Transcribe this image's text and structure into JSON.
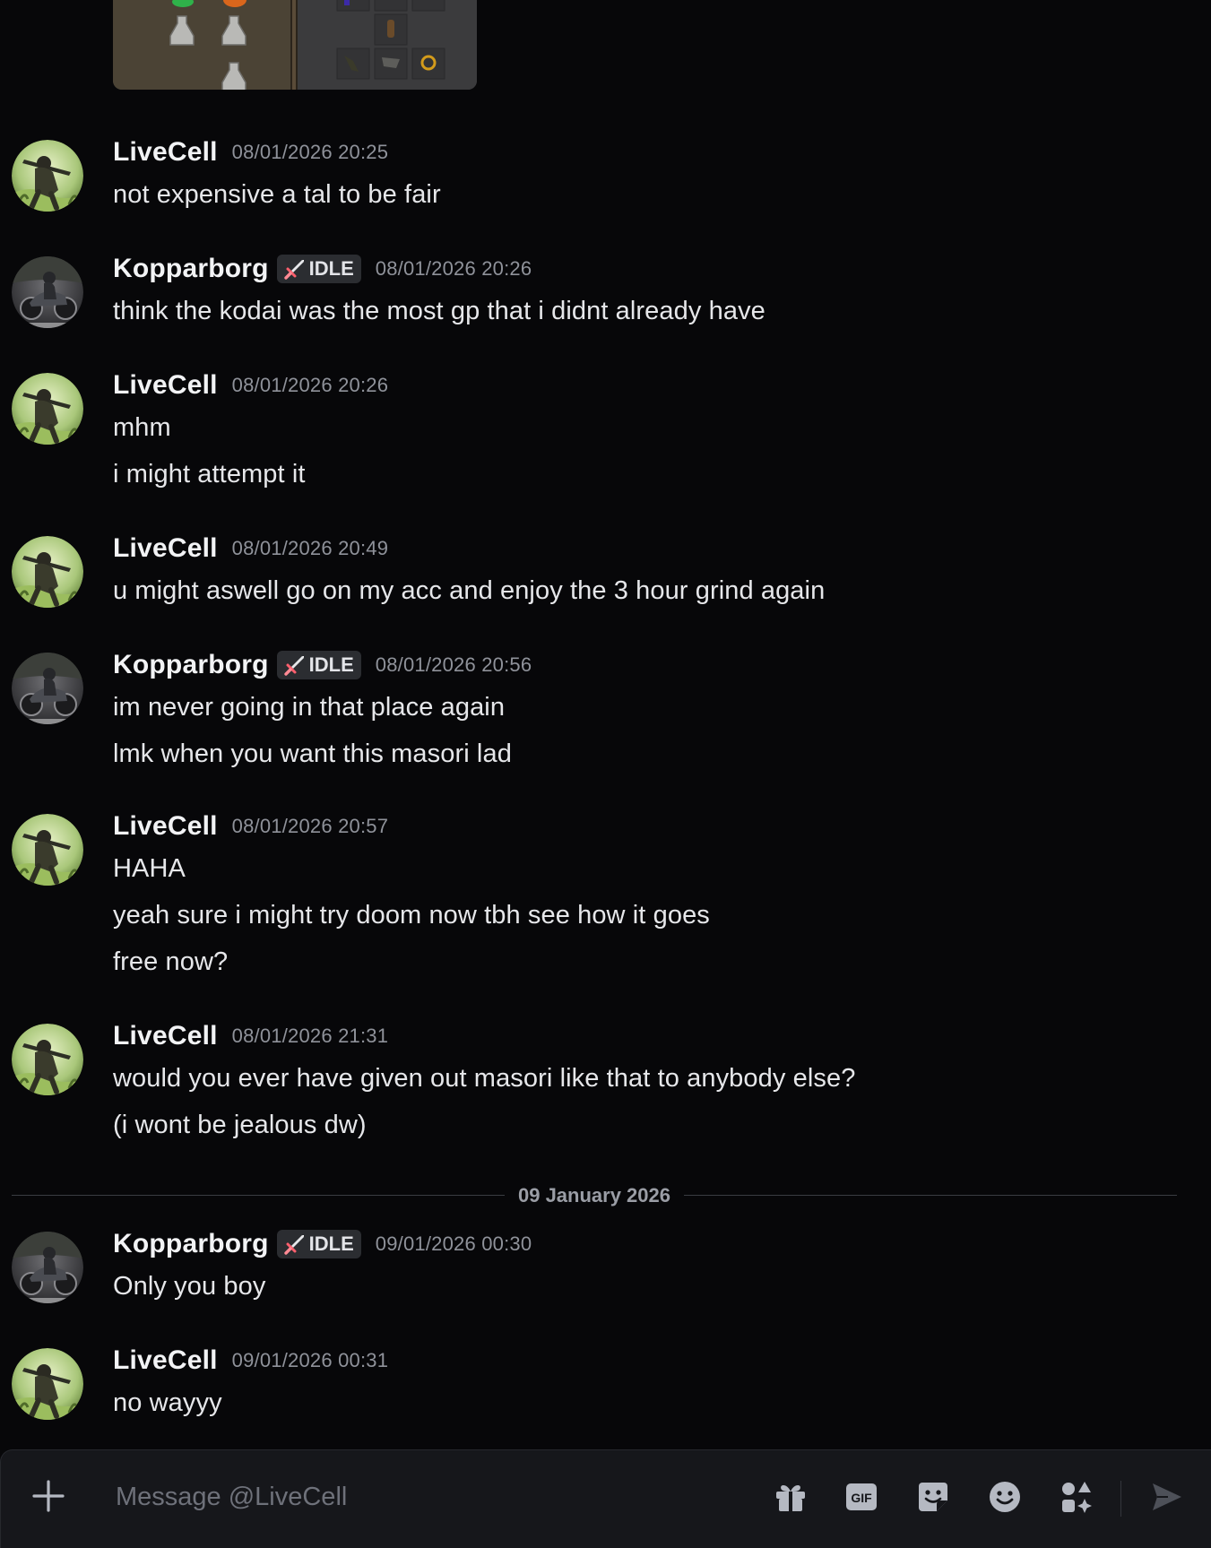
{
  "users": {
    "livecell": {
      "name": "LiveCell",
      "avatar_icon": "soldier-avatar-icon"
    },
    "kopparborg": {
      "name": "Kopparborg",
      "avatar_icon": "motorbike-avatar-icon",
      "tag": "IDLE",
      "tag_icon": "sword-icon"
    }
  },
  "groups": [
    {
      "user": "LiveCell",
      "timestamp": "08/01/2026 20:25",
      "lines": [
        "not expensive a tal to be fair"
      ]
    },
    {
      "user": "Kopparborg",
      "tag": "IDLE",
      "timestamp": "08/01/2026 20:26",
      "lines": [
        "think the kodai was the most gp that i didnt already have"
      ]
    },
    {
      "user": "LiveCell",
      "timestamp": "08/01/2026 20:26",
      "lines": [
        "mhm",
        "i might attempt it"
      ]
    },
    {
      "user": "LiveCell",
      "timestamp": "08/01/2026 20:49",
      "lines": [
        "u might aswell go on my acc and enjoy the 3 hour grind again"
      ]
    },
    {
      "user": "Kopparborg",
      "tag": "IDLE",
      "timestamp": "08/01/2026 20:56",
      "lines": [
        "im never going in that place again",
        "lmk when you want this masori lad"
      ]
    },
    {
      "user": "LiveCell",
      "timestamp": "08/01/2026 20:57",
      "lines": [
        "HAHA",
        "yeah sure i might try doom now tbh see how it goes",
        "free now?"
      ]
    },
    {
      "user": "LiveCell",
      "timestamp": "08/01/2026 21:31",
      "lines": [
        "would you ever have given out masori like that to anybody else?",
        "(i wont be jealous dw)"
      ]
    },
    {
      "user": "Kopparborg",
      "tag": "IDLE",
      "timestamp": "09/01/2026 00:30",
      "lines": [
        "Only you boy"
      ]
    },
    {
      "user": "LiveCell",
      "timestamp": "09/01/2026 00:31",
      "lines": [
        "no wayyy"
      ]
    }
  ],
  "date_divider": "09 January 2026",
  "attachment": {
    "icon": "inventory-screenshot-image"
  },
  "composer": {
    "placeholder": "Message @LiveCell",
    "value": "",
    "gif_label": "GIF",
    "icons": [
      "plus-icon",
      "gift-icon",
      "gif-icon",
      "sticker-icon",
      "emoji-icon",
      "apps-icon",
      "send-icon"
    ]
  },
  "colors": {
    "background": "#070709",
    "composer_bg": "#16171b",
    "username": "#f2f3f5",
    "timestamp": "#8f929a",
    "message_text": "#e6e7ea",
    "tag_bg": "#2b2d31",
    "icon": "#b5b9c2"
  }
}
